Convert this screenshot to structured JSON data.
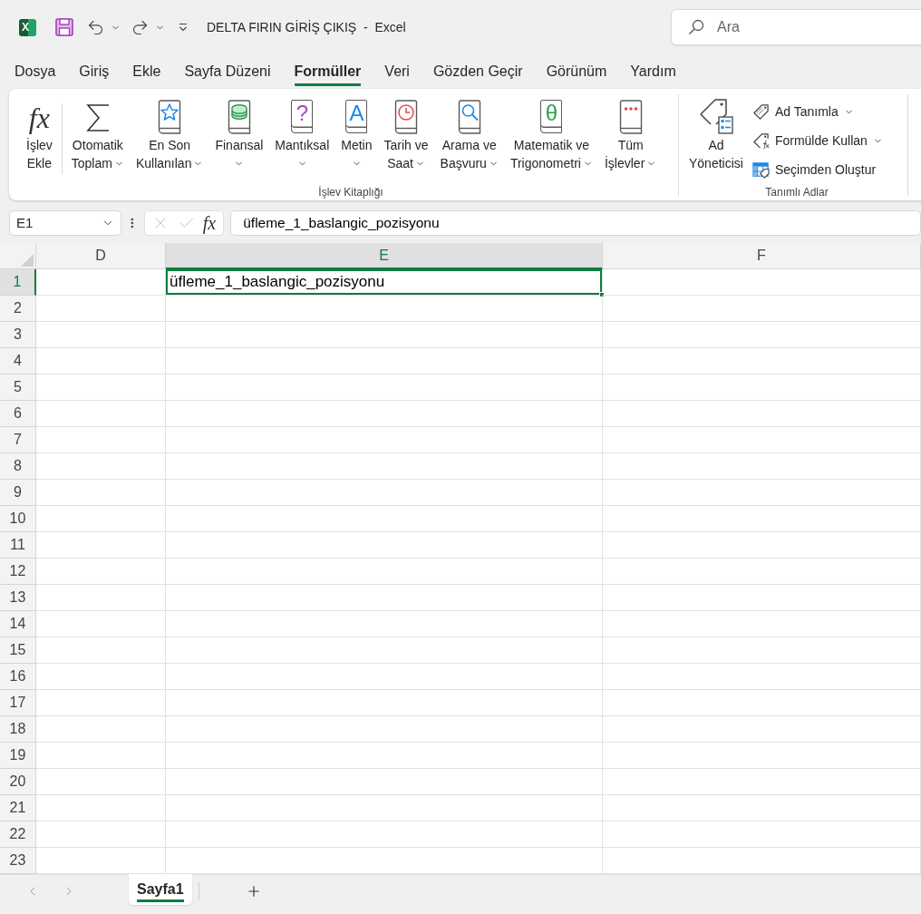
{
  "title_bar": {
    "logo_letter": "X",
    "title": "DELTA FIRIN GİRİŞ ÇIKIŞ  -  Excel",
    "search": {
      "placeholder": "Ara"
    }
  },
  "menu_tabs": [
    {
      "label": "Dosya",
      "selected": false
    },
    {
      "label": "Giriş",
      "selected": false
    },
    {
      "label": "Ekle",
      "selected": false
    },
    {
      "label": "Sayfa Düzeni",
      "selected": false
    },
    {
      "label": "Formüller",
      "selected": true
    },
    {
      "label": "Veri",
      "selected": false
    },
    {
      "label": "Gözden Geçir",
      "selected": false
    },
    {
      "label": "Görünüm",
      "selected": false
    },
    {
      "label": "Yardım",
      "selected": false
    }
  ],
  "ribbon": {
    "groups": [
      {
        "label": "İşlev Kitaplığı",
        "buttons": [
          {
            "symbol": "fx",
            "lines": [
              "İşlev",
              "Ekle"
            ],
            "dropdown": false
          },
          {
            "lines": [
              "Otomatik",
              "Toplam"
            ],
            "dropdown": true
          },
          {
            "lines": [
              "En Son",
              "Kullanılan"
            ],
            "dropdown": true
          },
          {
            "lines": [
              "Finansal"
            ],
            "dropdown": true
          },
          {
            "symbol": "?",
            "lines": [
              "Mantıksal"
            ],
            "dropdown": true
          },
          {
            "symbol": "A",
            "lines": [
              "Metin"
            ],
            "dropdown": true
          },
          {
            "lines": [
              "Tarih ve",
              "Saat"
            ],
            "dropdown": true
          },
          {
            "lines": [
              "Arama ve",
              "Başvuru"
            ],
            "dropdown": true
          },
          {
            "symbol": "θ",
            "lines": [
              "Matematik ve",
              "Trigonometri"
            ],
            "dropdown": true
          },
          {
            "lines": [
              "Tüm",
              "İşlevler"
            ],
            "dropdown": true
          }
        ]
      },
      {
        "label": "Tanımlı Adlar",
        "buttons": [
          {
            "lines": [
              "Ad",
              "Yöneticisi"
            ],
            "dropdown": false
          }
        ],
        "small_buttons": [
          {
            "label": "Ad Tanımla",
            "dropdown": true
          },
          {
            "label": "Formülde Kullan",
            "dropdown": true
          },
          {
            "label": "Seçimden Oluştur",
            "dropdown": false
          }
        ]
      }
    ]
  },
  "formula_bar": {
    "name_box": "E1",
    "function_symbol": "fx",
    "formula": "üfleme_1_baslangic_pozisyonu"
  },
  "sheet": {
    "columns": [
      {
        "label": "D",
        "selected": false
      },
      {
        "label": "E",
        "selected": true
      },
      {
        "label": "F",
        "selected": false
      }
    ],
    "rows": [
      {
        "label": "1",
        "selected": true,
        "cells": [
          {
            "selected": false
          },
          {
            "text": "üfleme_1_baslangic_pozisyonu",
            "selected": true
          },
          {
            "selected": false
          }
        ]
      },
      {
        "label": "2",
        "selected": false
      },
      {
        "label": "3",
        "selected": false
      },
      {
        "label": "4",
        "selected": false
      },
      {
        "label": "5",
        "selected": false
      },
      {
        "label": "6",
        "selected": false
      },
      {
        "label": "7",
        "selected": false
      },
      {
        "label": "8",
        "selected": false
      },
      {
        "label": "9",
        "selected": false
      },
      {
        "label": "10",
        "selected": false
      },
      {
        "label": "11",
        "selected": false
      },
      {
        "label": "12",
        "selected": false
      },
      {
        "label": "13",
        "selected": false
      },
      {
        "label": "14",
        "selected": false
      },
      {
        "label": "15",
        "selected": false
      },
      {
        "label": "16",
        "selected": false
      },
      {
        "label": "17",
        "selected": false
      },
      {
        "label": "18",
        "selected": false
      },
      {
        "label": "19",
        "selected": false
      },
      {
        "label": "20",
        "selected": false
      },
      {
        "label": "21",
        "selected": false
      },
      {
        "label": "22",
        "selected": false
      },
      {
        "label": "23",
        "selected": false
      }
    ]
  },
  "sheet_tabs": [
    {
      "label": "Sayfa1",
      "selected": true
    }
  ]
}
